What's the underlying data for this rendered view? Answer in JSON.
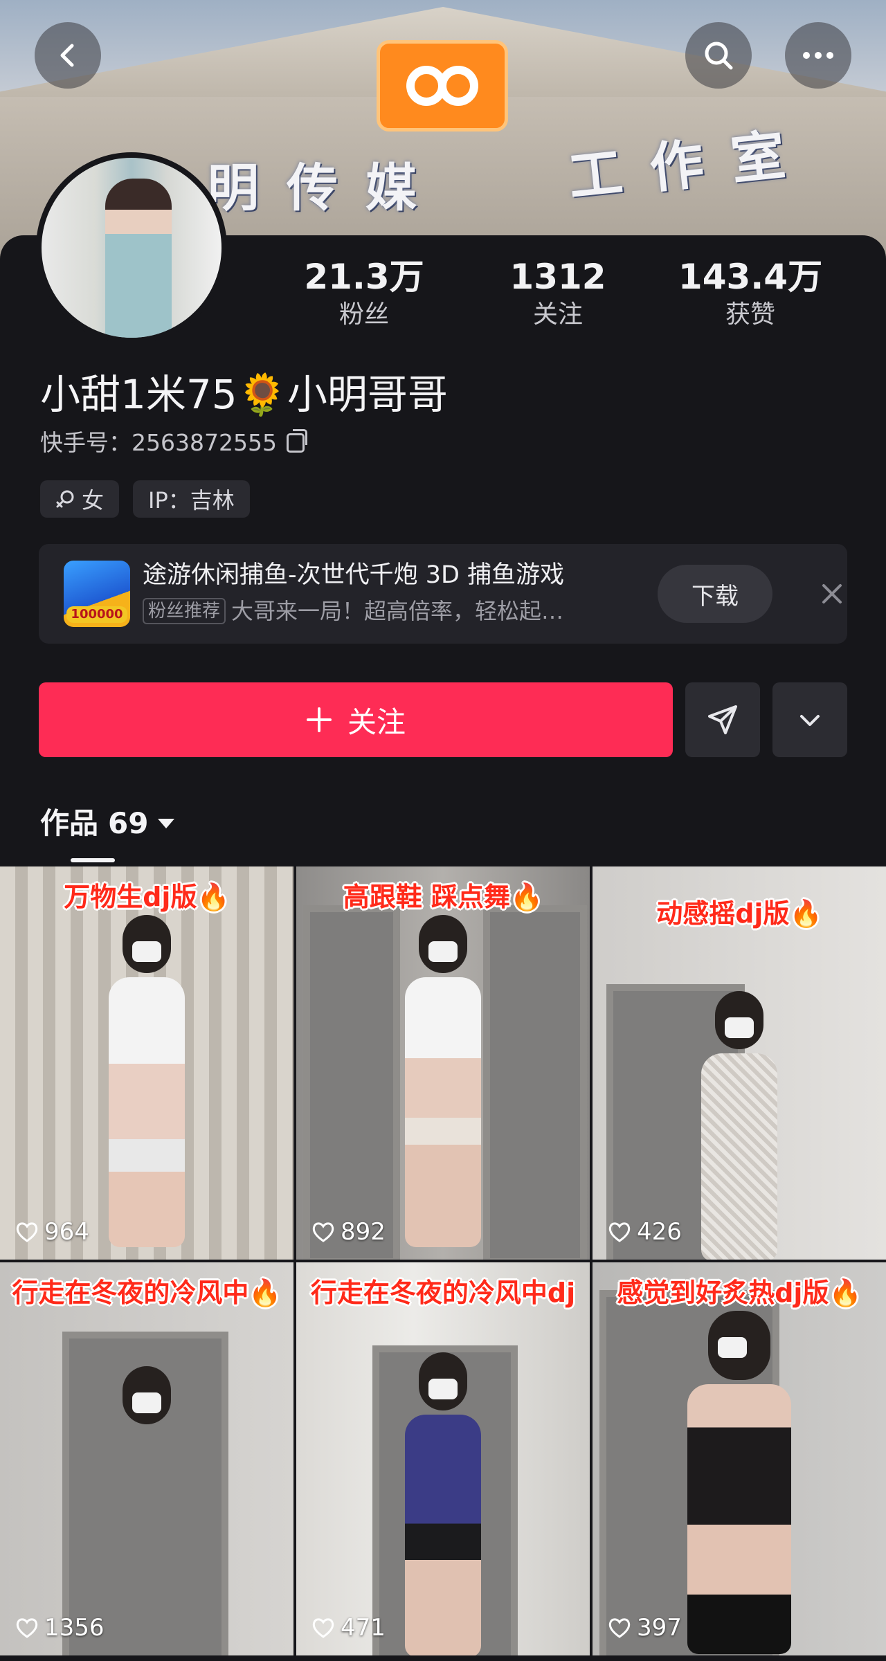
{
  "header": {
    "banner_sign_left": "明传媒",
    "banner_sign_right": "工作室",
    "icons": [
      "back-icon",
      "search-icon",
      "more-icon"
    ]
  },
  "profile": {
    "stats": [
      {
        "value": "21.3万",
        "label": "粉丝"
      },
      {
        "value": "1312",
        "label": "关注"
      },
      {
        "value": "143.4万",
        "label": "获赞"
      }
    ],
    "nickname": "小甜1米75🌻小明哥哥",
    "kuaishou_id_label": "快手号：",
    "kuaishou_id": "2563872555",
    "tags": [
      {
        "icon": "female-icon",
        "text": "女"
      },
      {
        "text": "IP：吉林"
      }
    ]
  },
  "ad": {
    "title": "途游休闲捕鱼-次世代千炮 3D 捕鱼游戏",
    "badge": "粉丝推荐",
    "subtitle": "大哥来一局！超高倍率，轻松起…",
    "thumb_text": "100000",
    "download_label": "下载"
  },
  "actions": {
    "follow_label": "关注",
    "follow_color": "#fe2c55"
  },
  "works_tab": {
    "label": "作品",
    "count": "69"
  },
  "videos": [
    {
      "caption": "万物生dj版🔥",
      "likes": "964"
    },
    {
      "caption": "高跟鞋 踩点舞🔥",
      "likes": "892"
    },
    {
      "caption": "动感摇dj版🔥",
      "likes": "426"
    },
    {
      "caption": "行走在冬夜的冷风中🔥",
      "likes": "1356"
    },
    {
      "caption": "行走在冬夜的冷风中dj",
      "likes": "471"
    },
    {
      "caption": "感觉到好炙热dj版🔥",
      "likes": "397"
    }
  ]
}
